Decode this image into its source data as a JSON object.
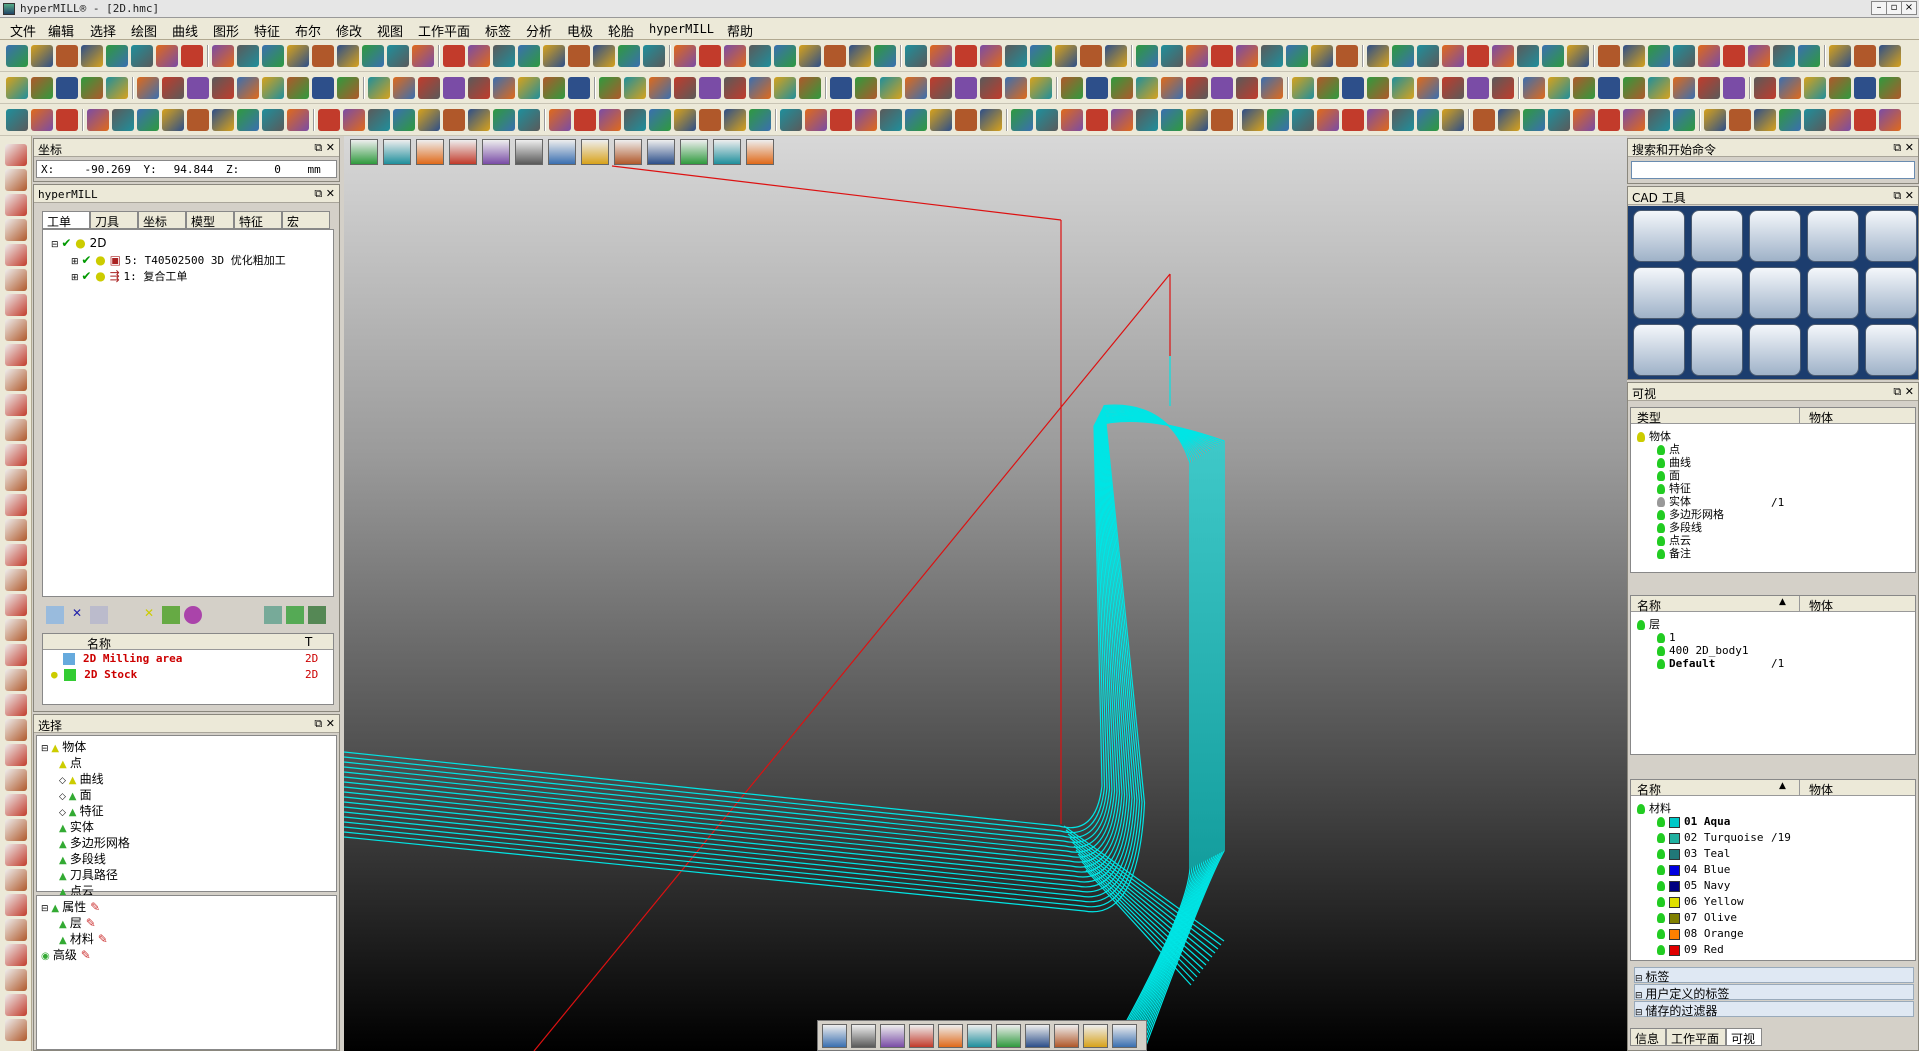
{
  "window": {
    "title": "hyperMILL® - [2D.hmc]",
    "min": "–",
    "max": "▫",
    "close": "×"
  },
  "menu": [
    "文件",
    "编辑",
    "选择",
    "绘图",
    "曲线",
    "图形",
    "特征",
    "布尔",
    "修改",
    "视图",
    "工作平面",
    "标签",
    "分析",
    "电极",
    "轮胎",
    "hyperMILL",
    "帮助"
  ],
  "coord_panel": {
    "title": "坐标",
    "x_label": "X:",
    "x": "-90.269",
    "y_label": "Y:",
    "y": "94.844",
    "z_label": "Z:",
    "z": "0",
    "unit": "mm"
  },
  "hypermill_panel": {
    "title": "hyperMILL",
    "tabs": [
      "工单",
      "刀具",
      "坐标",
      "模型",
      "特征",
      "宏"
    ],
    "tree": [
      {
        "label": "2D"
      },
      {
        "label": "5:  T40502500 3D 优化粗加工"
      },
      {
        "label": "1:  复合工单"
      }
    ],
    "list_headers": [
      "名称",
      "T"
    ],
    "list_rows": [
      {
        "name": "2D Milling area",
        "t": "2D"
      },
      {
        "name": "2D Stock",
        "t": "2D"
      }
    ]
  },
  "select_panel": {
    "title": "选择",
    "items": [
      "物体",
      "点",
      "曲线",
      "面",
      "特征",
      "实体",
      "多边形网格",
      "多段线",
      "刀具路径",
      "点云"
    ],
    "items2": [
      "属性",
      "层",
      "材料",
      "高级"
    ]
  },
  "search_panel": {
    "title": "搜索和开始命令"
  },
  "cad_tools": {
    "title": "CAD 工具"
  },
  "visible_panel": {
    "title": "可视",
    "type_header": "类型",
    "obj_header": "物体",
    "types": [
      "物体",
      "点",
      "曲线",
      "面",
      "特征",
      "实体",
      "多边形网格",
      "多段线",
      "点云",
      "备注"
    ],
    "solid_count": "/1",
    "name_header": "名称",
    "layers_root": "层",
    "layers": [
      "1",
      "400 2D_body1",
      "Default"
    ],
    "default_count": "/1",
    "materials_root": "材料",
    "materials": [
      {
        "label": "01 Aqua",
        "color": "#00c8c8"
      },
      {
        "label": "02 Turquoise",
        "color": "#20b0a0"
      },
      {
        "label": "03 Teal",
        "color": "#207878"
      },
      {
        "label": "04 Blue",
        "color": "#0000e0"
      },
      {
        "label": "05 Navy",
        "color": "#000080"
      },
      {
        "label": "06 Yellow",
        "color": "#e0e000"
      },
      {
        "label": "07 Olive",
        "color": "#808000"
      },
      {
        "label": "08 Orange",
        "color": "#ff8000"
      },
      {
        "label": "09 Red",
        "color": "#e00000"
      }
    ],
    "turquoise_count": "/19",
    "tags": [
      "标签",
      "用户定义的标签",
      "储存的过滤器"
    ],
    "bottom_tabs": [
      "信息",
      "工作平面",
      "可视"
    ]
  },
  "colors": {
    "toolpath": "#00e5e5",
    "rapid": "#dd1111"
  }
}
